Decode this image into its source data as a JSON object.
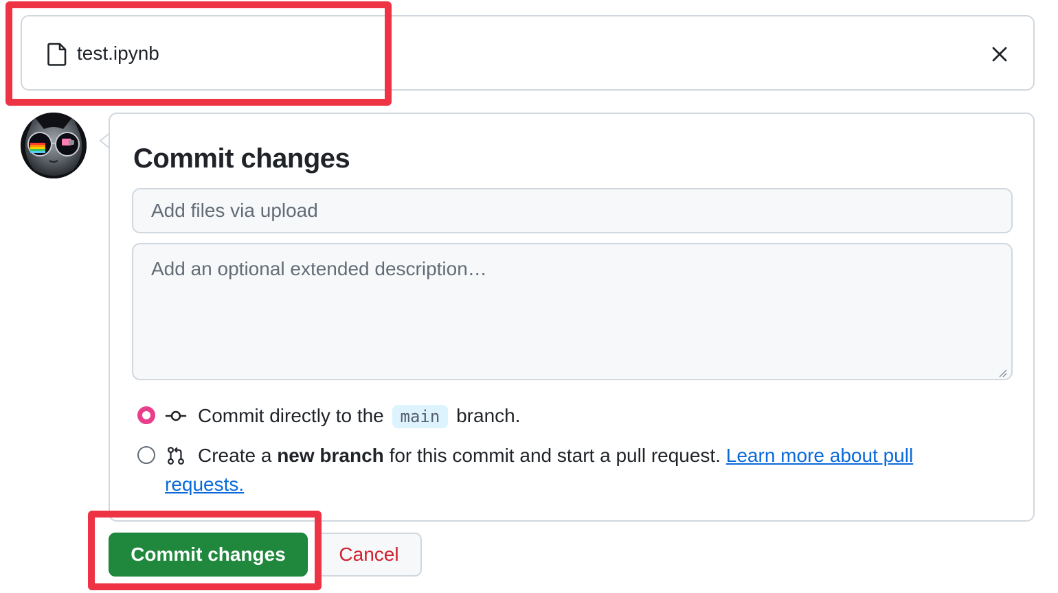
{
  "file": {
    "name": "test.ipynb",
    "icon": "file-icon",
    "close_icon": "close-icon"
  },
  "commit": {
    "title": "Commit changes",
    "summary_placeholder": "Add files via upload",
    "description_placeholder": "Add an optional extended description…",
    "options": [
      {
        "selected": true,
        "icon": "git-commit-icon",
        "text_before": "Commit directly to the",
        "branch": "main",
        "text_after": "branch."
      },
      {
        "selected": false,
        "icon": "git-pull-request-icon",
        "text_before": "Create a",
        "bold_text": "new branch",
        "text_after": "for this commit and start a pull request.",
        "link_text": "Learn more about pull",
        "link_text_cont": "requests."
      }
    ]
  },
  "buttons": {
    "commit_label": "Commit changes",
    "cancel_label": "Cancel"
  },
  "colors": {
    "primary_button": "#1f883d",
    "danger_text": "#cf222e",
    "link": "#0969da",
    "radio_selected": "#e83e8c",
    "highlight": "#ee3344"
  }
}
